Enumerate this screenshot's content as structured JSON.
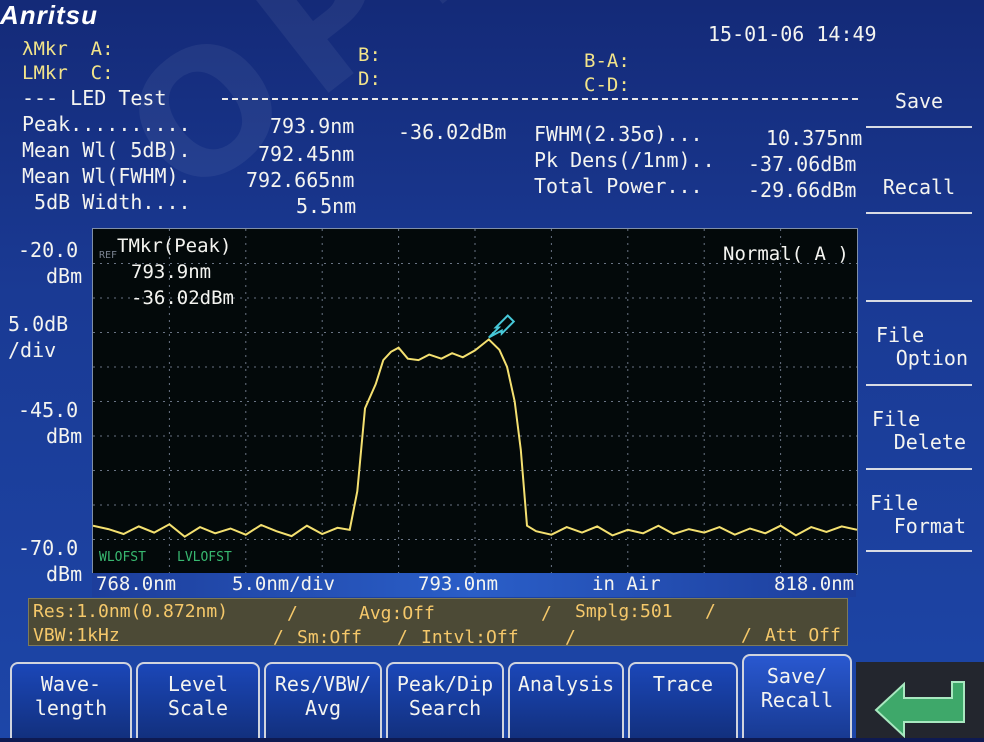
{
  "header": {
    "logo": "Anritsu",
    "datetime": "15-01-06 14:49",
    "markers": {
      "lmkr_a": "λMkr  A:",
      "lmkr_c": "LMkr  C:",
      "b": "B:",
      "d": "D:",
      "ba": "B-A:",
      "cd": "C-D:"
    }
  },
  "test": {
    "title": "--- LED Test ",
    "rows_left": [
      {
        "label": "Peak..........",
        "value": "793.9nm",
        "extra": "-36.02dBm"
      },
      {
        "label": "Mean Wl( 5dB).",
        "value": "792.45nm"
      },
      {
        "label": "Mean Wl(FWHM).",
        "value": "792.665nm"
      },
      {
        "label": " 5dB Width....",
        "value": "5.5nm"
      }
    ],
    "rows_right": [
      {
        "label": "FWHM(2.35σ)...",
        "value": "10.375nm"
      },
      {
        "label": "Pk Dens(/1nm)..",
        "value": "-37.06dBm"
      },
      {
        "label": "Total Power...",
        "value": "-29.66dBm"
      }
    ]
  },
  "plot": {
    "ref_label": "REF",
    "marker_title": "TMkr(Peak)",
    "marker_wl": "793.9nm",
    "marker_lvl": "-36.02dBm",
    "mode": "Normal( A )",
    "wl_offset": "WLOFST",
    "lvl_offset": "LVLOFST",
    "y_labels": [
      {
        "val": "-20.0",
        "unit": "dBm"
      },
      {
        "val": "5.0dB",
        "unit": "/div"
      },
      {
        "val": "-45.0",
        "unit": "dBm"
      },
      {
        "val": "-70.0",
        "unit": "dBm"
      }
    ],
    "x_start": "768.0nm",
    "x_div": "5.0nm/div",
    "x_center": "793.0nm",
    "x_medium": "in Air",
    "x_end": "818.0nm"
  },
  "status": {
    "res": "Res:1.0nm(0.872nm)",
    "sep1": "/",
    "avg": "Avg:Off",
    "sep2": "/",
    "smplg": "Smplg:501",
    "sep3": "/",
    "vbw": "VBW:1kHz",
    "sep4": "/",
    "sm": "Sm:Off",
    "sep5": "/",
    "intvl": "Intvl:Off",
    "sep6": "/",
    "sep7": "/",
    "att": "Att Off"
  },
  "softkeys": {
    "save": "Save",
    "recall": "Recall",
    "file_option_1": "File",
    "file_option_2": "Option",
    "file_delete_1": "File",
    "file_delete_2": "Delete",
    "file_format_1": "File",
    "file_format_2": "Format"
  },
  "tabs": [
    {
      "l1": "Wave-",
      "l2": "length"
    },
    {
      "l1": "Level",
      "l2": "Scale"
    },
    {
      "l1": "Res/VBW/",
      "l2": "Avg"
    },
    {
      "l1": "Peak/Dip",
      "l2": "Search"
    },
    {
      "l1": "Analysis",
      "l2": ""
    },
    {
      "l1": "Trace",
      "l2": ""
    },
    {
      "l1": "Save/",
      "l2": "Recall"
    }
  ],
  "watermark": "OPEAK",
  "colors": {
    "trace": "#f4e070",
    "marker": "#47c8d8",
    "status_text": "#f5c86a",
    "grid": "#6a7484"
  },
  "chart_data": {
    "type": "line",
    "xlabel": "",
    "ylabel": "",
    "xlim": [
      768.0,
      818.0
    ],
    "ylim": [
      -70.0,
      -20.0
    ],
    "x_div": 5.0,
    "y_div": 5.0,
    "grid": true,
    "series": [
      {
        "points": [
          [
            768.0,
            -63.0
          ],
          [
            769.0,
            -63.5
          ],
          [
            770.0,
            -64.2
          ],
          [
            771.0,
            -63.1
          ],
          [
            772.0,
            -64.0
          ],
          [
            773.0,
            -62.8
          ],
          [
            774.0,
            -64.6
          ],
          [
            775.0,
            -63.2
          ],
          [
            776.0,
            -64.1
          ],
          [
            777.0,
            -63.4
          ],
          [
            778.0,
            -64.3
          ],
          [
            779.0,
            -62.9
          ],
          [
            780.0,
            -63.8
          ],
          [
            781.0,
            -64.5
          ],
          [
            782.0,
            -63.0
          ],
          [
            783.0,
            -64.2
          ],
          [
            784.0,
            -63.3
          ],
          [
            784.8,
            -63.6
          ],
          [
            785.3,
            -58.0
          ],
          [
            785.8,
            -46.0
          ],
          [
            786.5,
            -42.5
          ],
          [
            787.0,
            -39.0
          ],
          [
            787.5,
            -37.8
          ],
          [
            788.0,
            -37.2
          ],
          [
            788.6,
            -38.8
          ],
          [
            789.3,
            -39.0
          ],
          [
            790.0,
            -38.2
          ],
          [
            790.8,
            -38.8
          ],
          [
            791.5,
            -38.0
          ],
          [
            792.2,
            -38.6
          ],
          [
            793.0,
            -37.6
          ],
          [
            793.9,
            -36.0
          ],
          [
            794.6,
            -37.5
          ],
          [
            795.1,
            -40.0
          ],
          [
            795.6,
            -45.0
          ],
          [
            796.0,
            -52.0
          ],
          [
            796.4,
            -63.0
          ],
          [
            797.0,
            -63.8
          ],
          [
            798.0,
            -64.3
          ],
          [
            799.0,
            -63.2
          ],
          [
            800.0,
            -64.0
          ],
          [
            801.0,
            -63.1
          ],
          [
            802.0,
            -64.4
          ],
          [
            803.0,
            -63.6
          ],
          [
            804.0,
            -64.1
          ],
          [
            805.0,
            -63.0
          ],
          [
            806.0,
            -64.2
          ],
          [
            807.0,
            -63.5
          ],
          [
            808.0,
            -64.0
          ],
          [
            809.0,
            -63.2
          ],
          [
            810.0,
            -64.3
          ],
          [
            811.0,
            -63.4
          ],
          [
            812.0,
            -64.1
          ],
          [
            813.0,
            -63.0
          ],
          [
            814.0,
            -64.4
          ],
          [
            815.0,
            -63.2
          ],
          [
            816.0,
            -63.9
          ],
          [
            817.0,
            -63.1
          ],
          [
            818.0,
            -63.6
          ]
        ]
      }
    ],
    "marker": {
      "x": 793.9,
      "y": -36.02
    }
  }
}
